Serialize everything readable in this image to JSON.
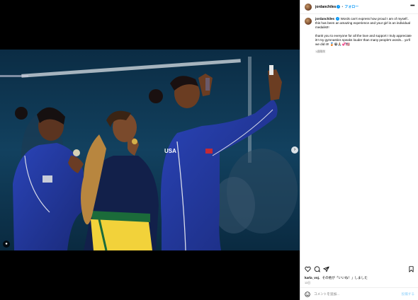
{
  "post": {
    "username": "jordanchiles",
    "follow_label": "フォロー",
    "more_label": "•••",
    "caption_p1": "Words can't express how proud I am of myself.. this has been an amazing experience and your girl is an individual medalist!!",
    "caption_p2": "thank you to everyone for all the love and support I truly appreciate it!! my gymnastics speaks louder than many people's words... ya'll we did it!! 🥉😭🙏🏽💞🇺🇸",
    "time_ago": "1週間前"
  },
  "photo": {
    "jersey_text": "USA"
  },
  "engagement": {
    "liked_by_user": "karla_voj",
    "liked_by_suffix": "、その他が「いいね！」しました",
    "date": "13日"
  },
  "comment": {
    "placeholder": "コメントを追加...",
    "post_label": "投稿する"
  },
  "icons": {
    "like": "heart-icon",
    "comment": "comment-icon",
    "share": "share-icon",
    "save": "bookmark-icon",
    "emoji": "emoji-icon",
    "next": "chevron-right-icon",
    "tag": "user-tag-icon"
  },
  "colors": {
    "accent": "#0095f6",
    "usa_blue": "#22359a",
    "brazil_green": "#1b6b3a",
    "brazil_yellow": "#f2d23a"
  }
}
